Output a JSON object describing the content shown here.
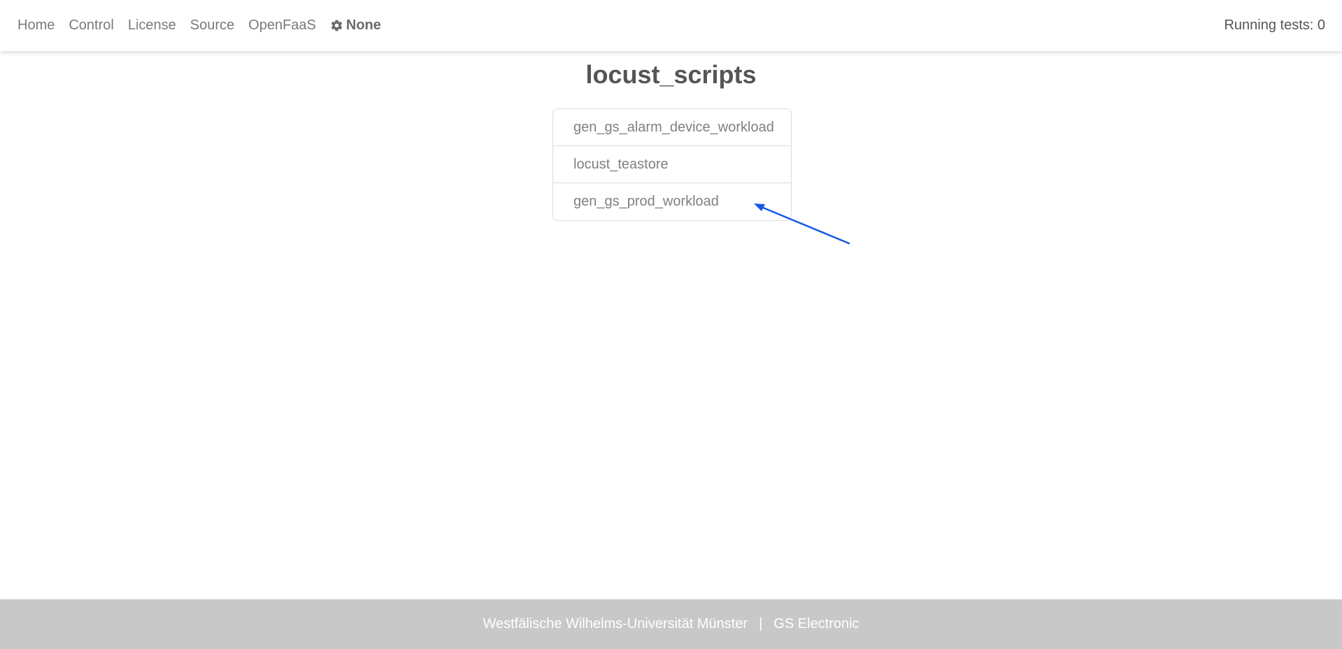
{
  "nav": {
    "links": [
      "Home",
      "Control",
      "License",
      "Source",
      "OpenFaaS"
    ],
    "settings_label": "None",
    "settings_icon": "gear-icon",
    "running_tests": "Running tests: 0"
  },
  "main": {
    "title": "locust_scripts",
    "scripts": [
      "gen_gs_alarm_device_workload",
      "locust_teastore",
      "gen_gs_prod_workload"
    ]
  },
  "annotation": {
    "arrow_color": "#1558e6"
  },
  "footer": {
    "university": "Westfälische Wilhelms-Universität Münster",
    "separator": "|",
    "company": "GS Electronic"
  }
}
